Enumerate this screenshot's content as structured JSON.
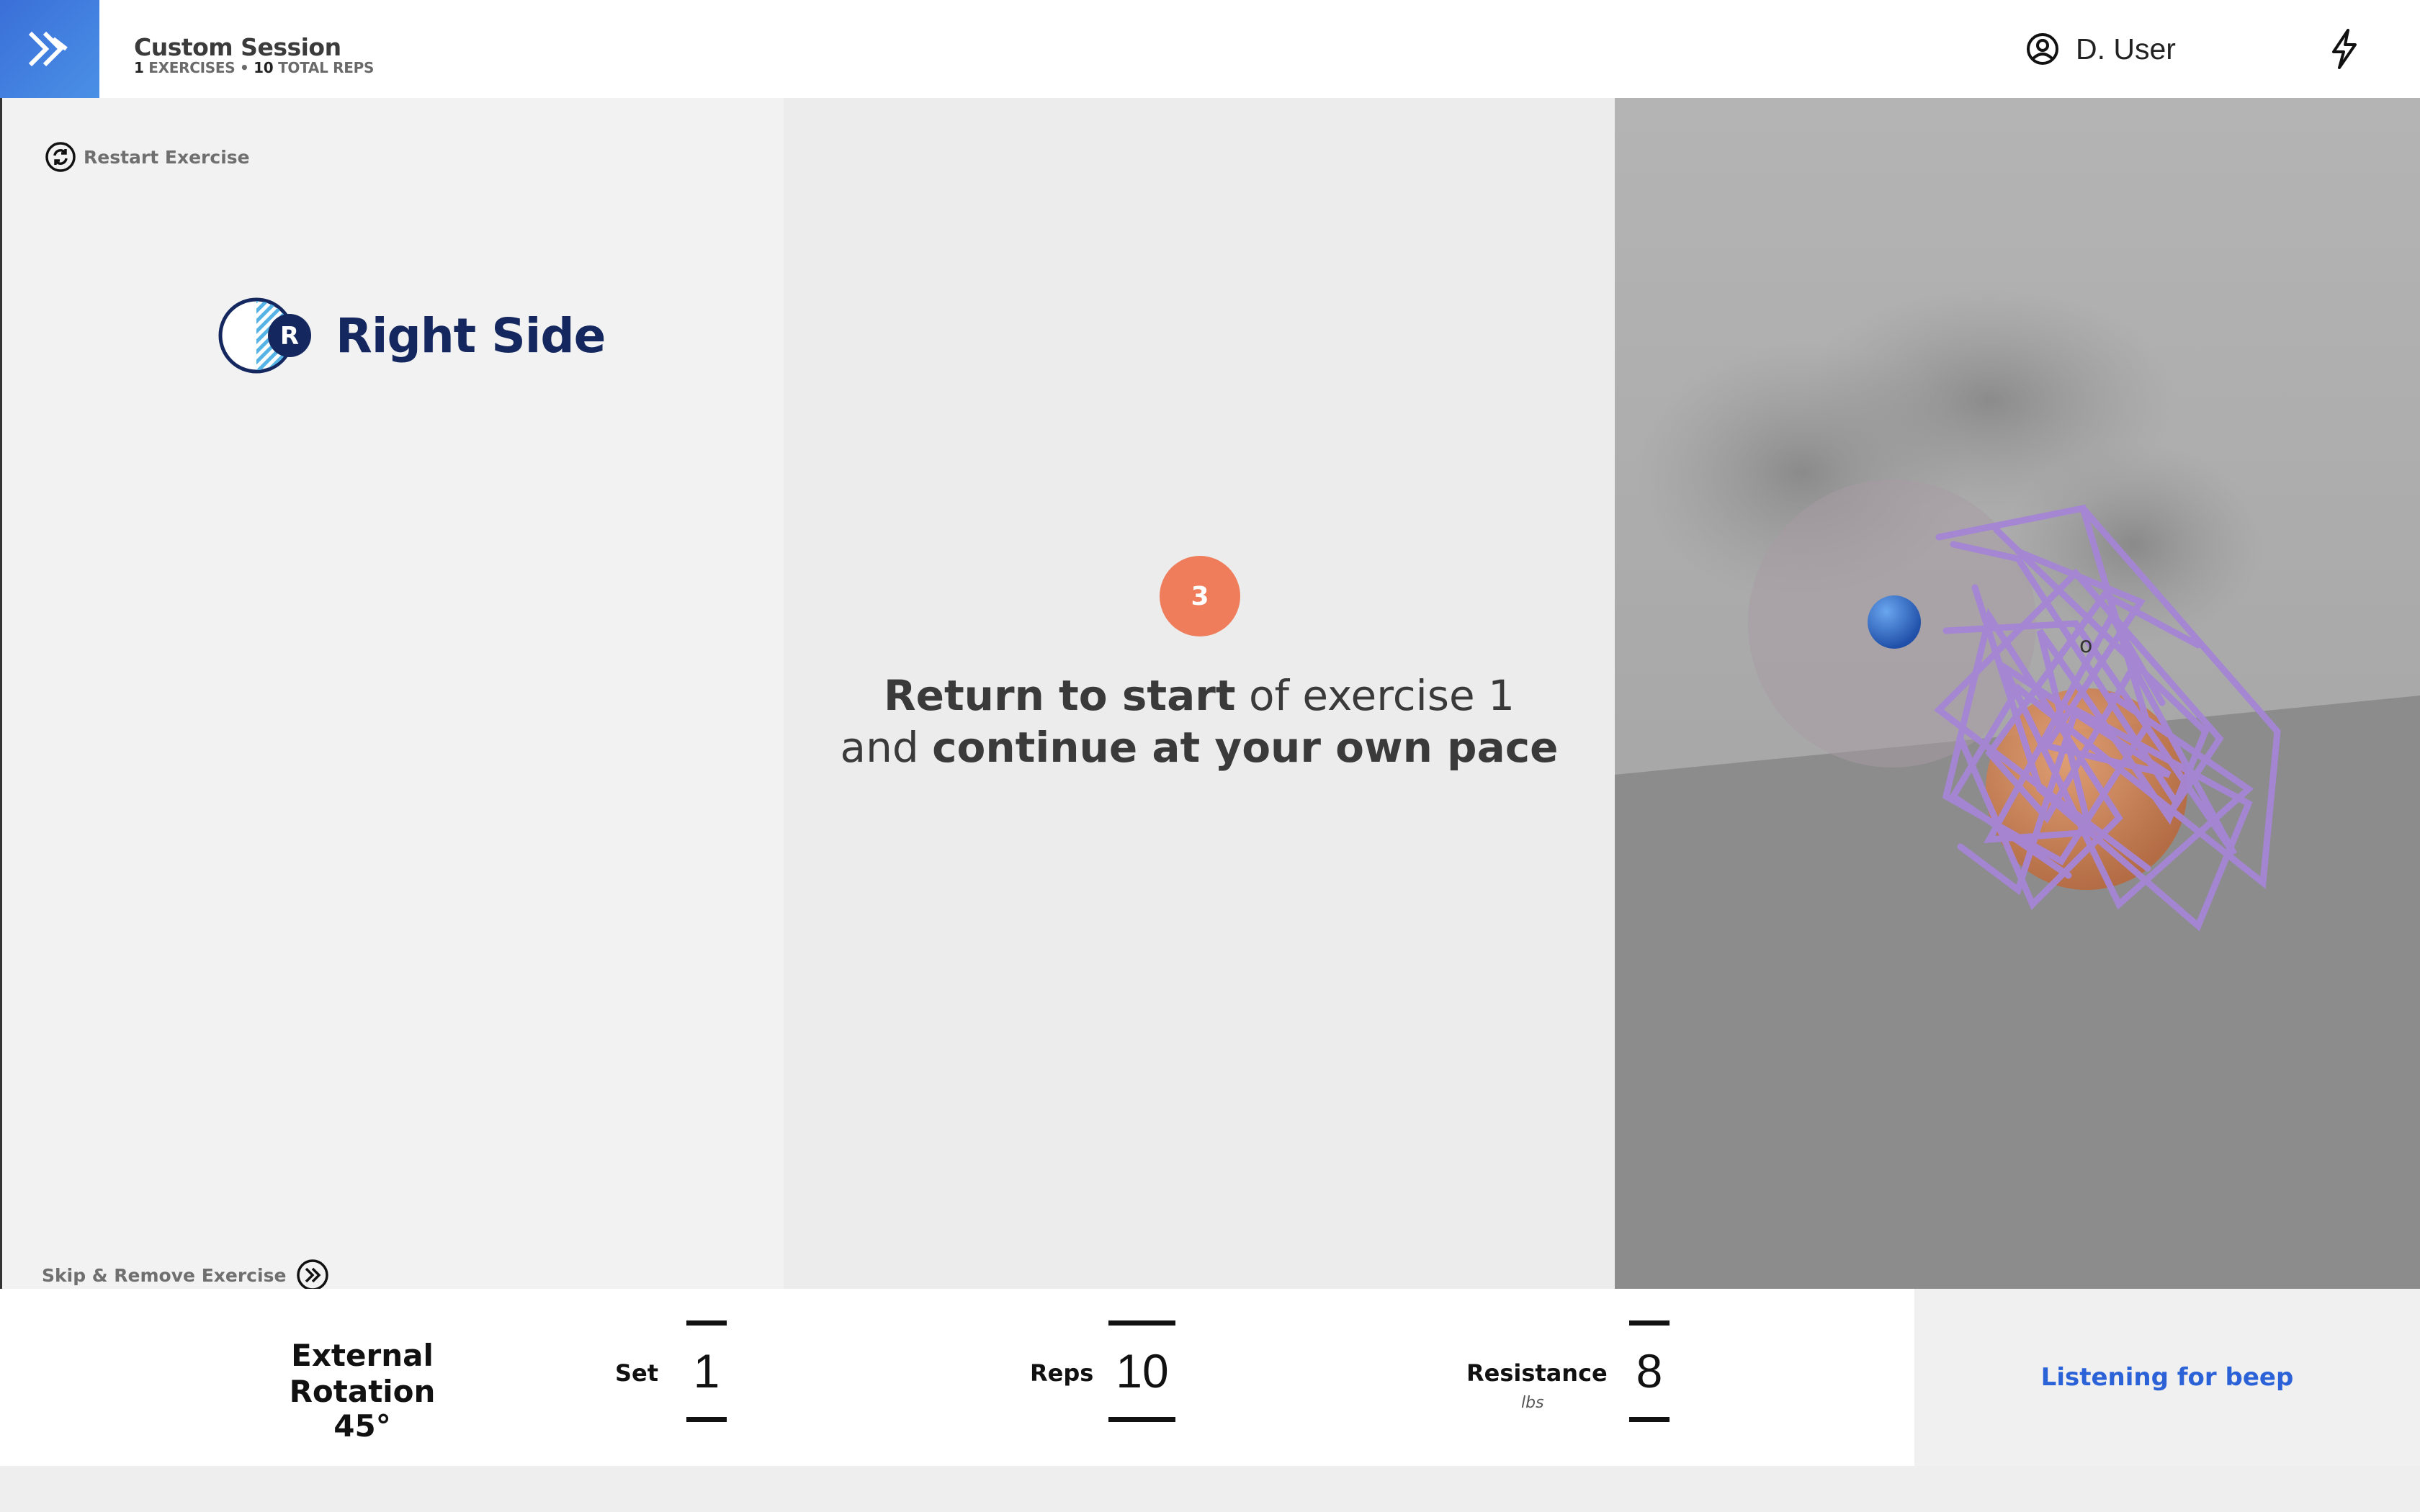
{
  "header": {
    "session_title": "Custom Session",
    "exercises_count": "1",
    "exercises_label": "EXERCISES •",
    "reps_count": "10",
    "reps_label": "TOTAL REPS",
    "user_name": "D. User"
  },
  "left": {
    "restart_label": "Restart Exercise",
    "side_letter": "R",
    "side_label": "Right Side",
    "skip_label": "Skip & Remove Exercise"
  },
  "center": {
    "countdown": "3",
    "line1_bold": "Return to start",
    "line1_rest": "of exercise 1",
    "line2_lead": "and",
    "line2_bold": "continue at your own pace"
  },
  "bottom": {
    "exercise_name": "External Rotation",
    "exercise_angle": "45°",
    "set_label": "Set",
    "set_value": "1",
    "reps_label": "Reps",
    "reps_value": "10",
    "resistance_label": "Resistance",
    "resistance_unit": "lbs",
    "resistance_value": "8",
    "listening_label": "Listening for beep"
  },
  "colors": {
    "brand_blue": "#3a6fd8",
    "navy": "#14275e",
    "countdown": "#ef7d5b",
    "link_blue": "#2b62d8",
    "tube_purple": "#a585d6"
  },
  "icons": {
    "logo": "chevron-double-right-icon",
    "user": "user-circle-icon",
    "power": "lightning-bolt-icon",
    "restart": "restart-icon",
    "skip": "skip-forward-icon"
  }
}
